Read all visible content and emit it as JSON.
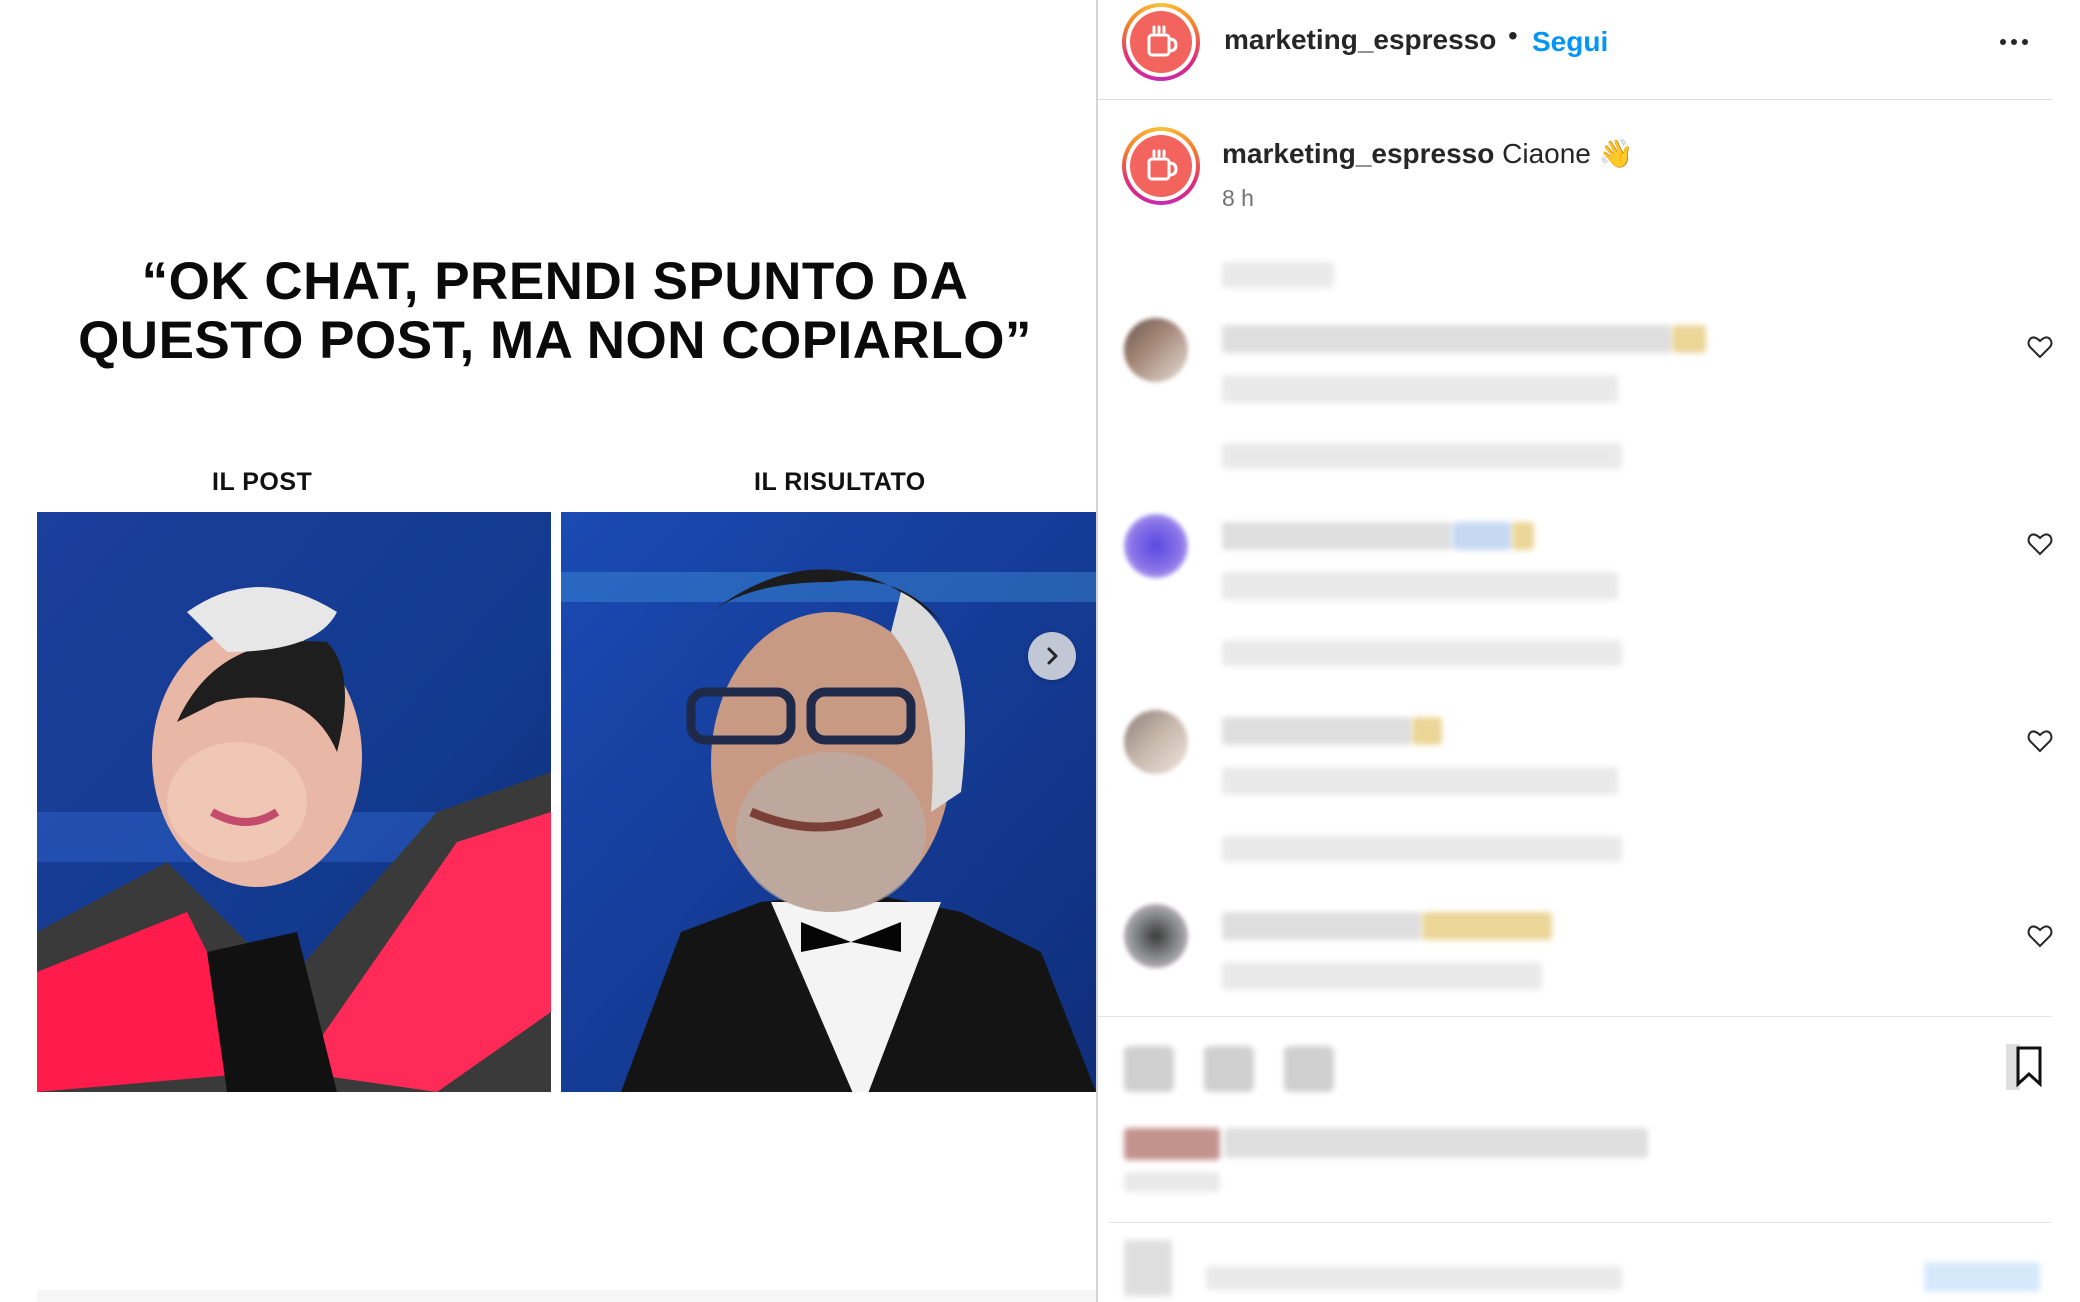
{
  "post": {
    "headline_line1": "“OK CHAT, PRENDI SPUNTO DA",
    "headline_line2": "QUESTO POST, MA NON COPIARLO”",
    "label_left": "IL POST",
    "label_right": "IL RISULTATO"
  },
  "header": {
    "username": "marketing_espresso",
    "separator": "•",
    "follow_label": "Segui"
  },
  "caption": {
    "username": "marketing_espresso",
    "text": "Ciaone",
    "emoji": "👋",
    "time": "8 h"
  },
  "comments_count": 4,
  "colors": {
    "accent": "#0095f6",
    "avatar_brand": "#f4645f",
    "text": "#262626",
    "muted": "#737373"
  },
  "icons": [
    "coffee-cup-icon",
    "more-options-icon",
    "heart-icon",
    "chevron-right-icon",
    "bookmark-icon"
  ]
}
